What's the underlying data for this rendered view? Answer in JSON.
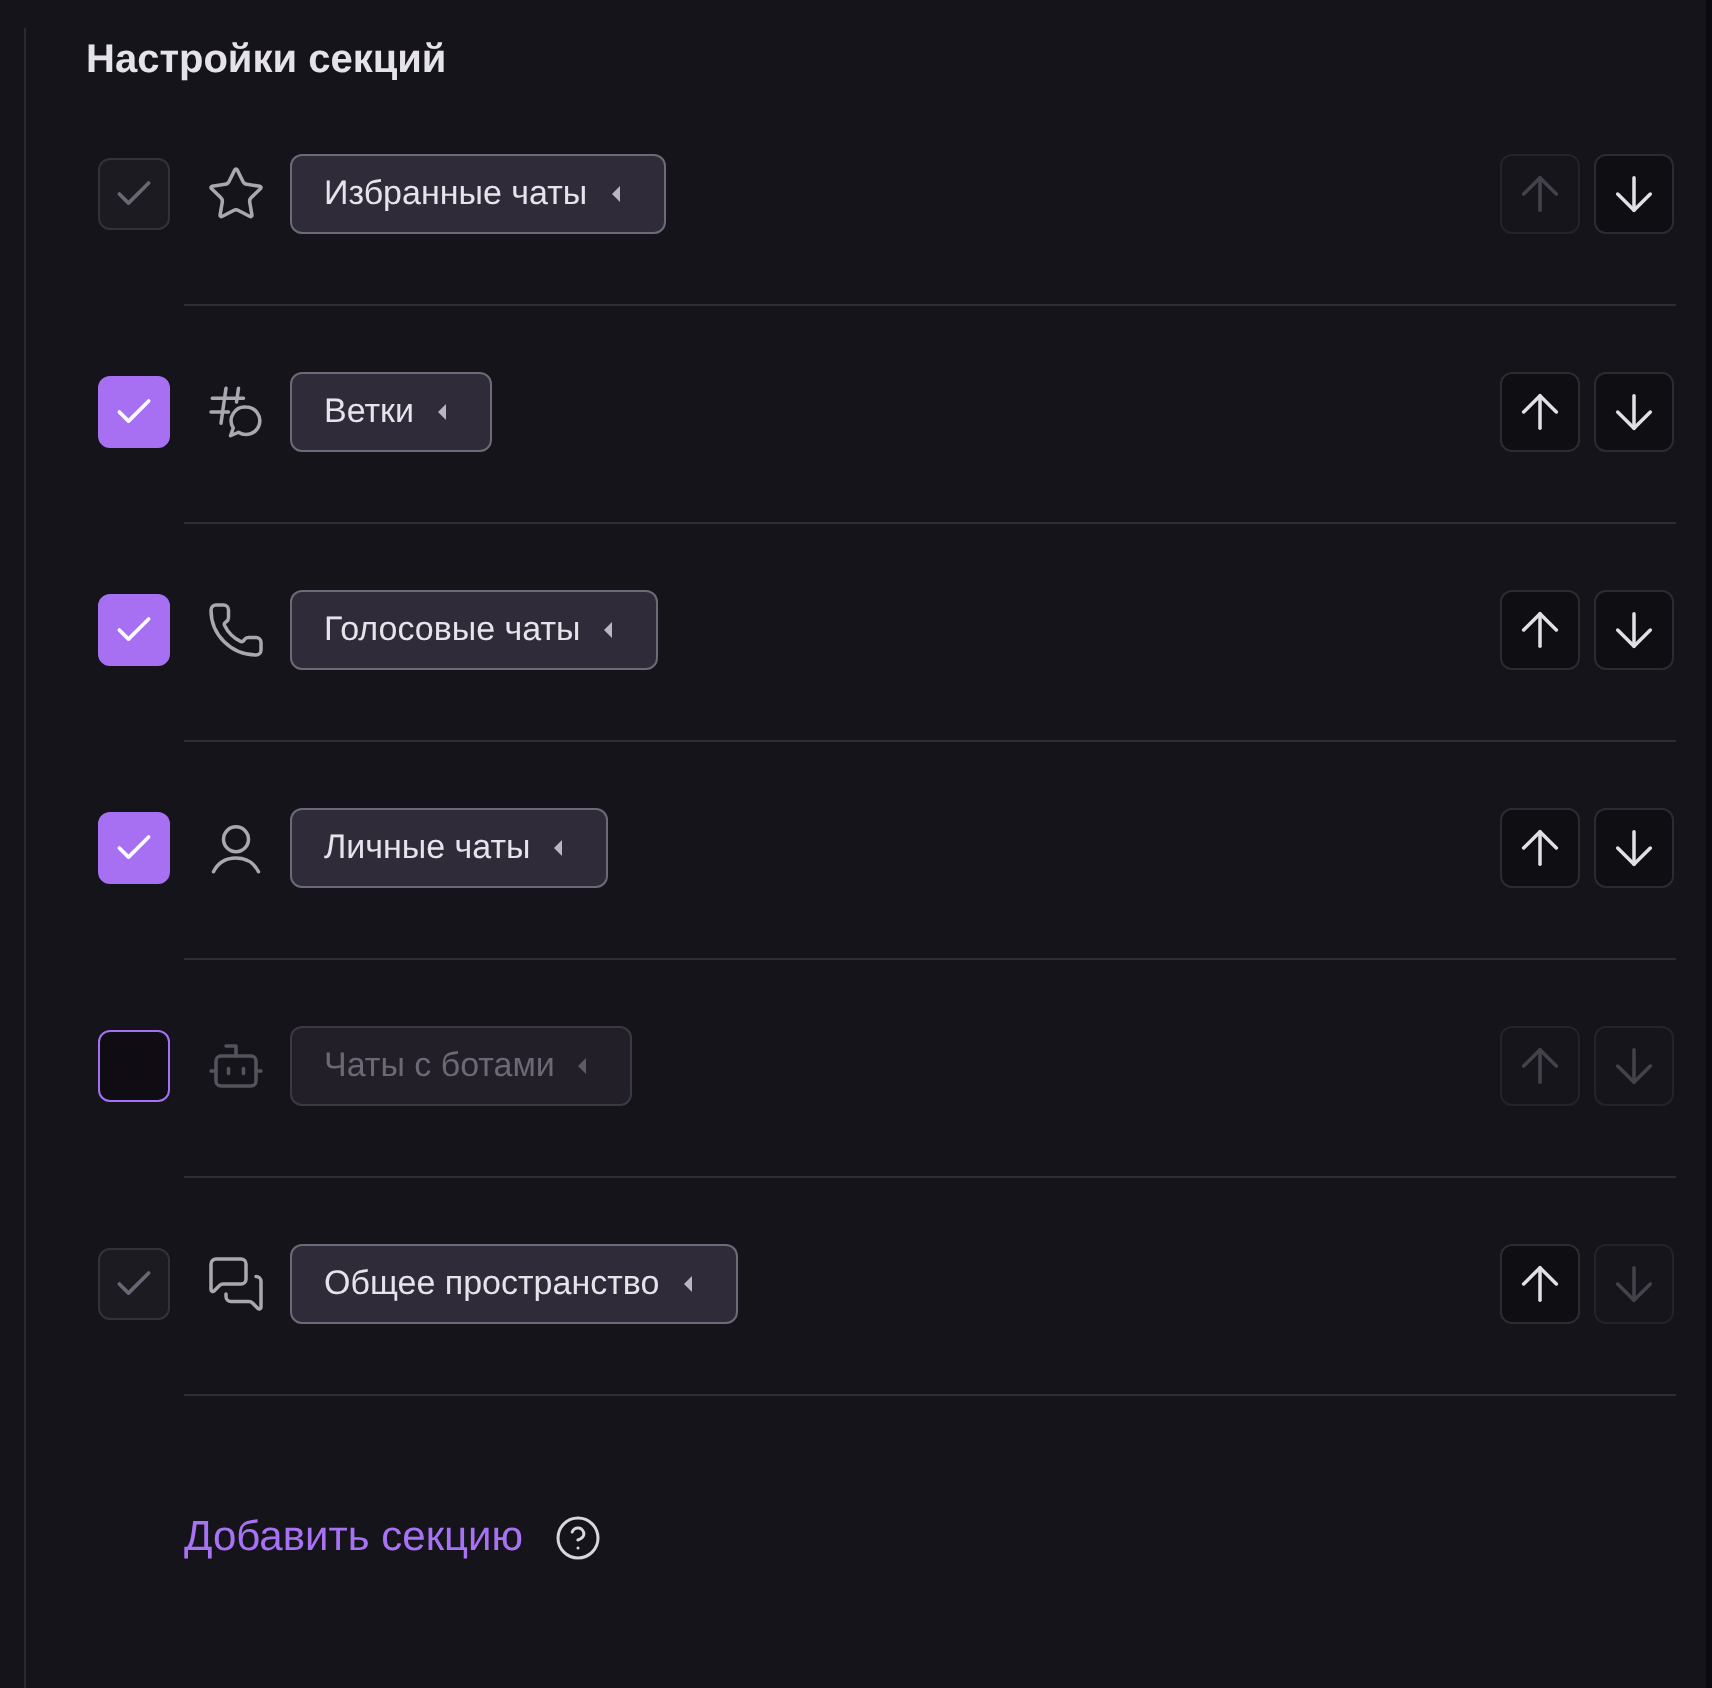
{
  "title": "Настройки секций",
  "sections": [
    {
      "label": "Избранные чаты",
      "checked": true,
      "checkbox_disabled": true,
      "up_disabled": true,
      "down_disabled": false
    },
    {
      "label": "Ветки",
      "checked": true,
      "checkbox_disabled": false,
      "up_disabled": false,
      "down_disabled": false
    },
    {
      "label": "Голосовые чаты",
      "checked": true,
      "checkbox_disabled": false,
      "up_disabled": false,
      "down_disabled": false
    },
    {
      "label": "Личные чаты",
      "checked": true,
      "checkbox_disabled": false,
      "up_disabled": false,
      "down_disabled": false
    },
    {
      "label": "Чаты с ботами",
      "checked": false,
      "checkbox_disabled": false,
      "up_disabled": true,
      "down_disabled": true
    },
    {
      "label": "Общее пространство",
      "checked": true,
      "checkbox_disabled": true,
      "up_disabled": false,
      "down_disabled": true
    }
  ],
  "add_link": "Добавить секцию"
}
